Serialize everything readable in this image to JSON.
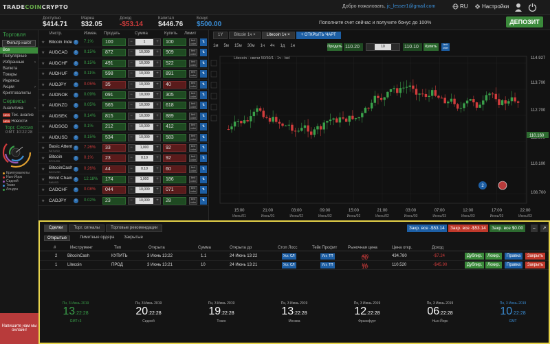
{
  "app": {
    "logo_a": "TRADE",
    "logo_b": "COIN",
    "logo_c": "CRYPTO",
    "welcome": "Добро пожаловать,",
    "email": "jc_lesser1@gmail.com",
    "lang": "RU",
    "settings": "Настройки"
  },
  "balances": [
    {
      "label": "Доступно",
      "value": "$414.71",
      "tone": "normal"
    },
    {
      "label": "Маржа",
      "value": "$32.05",
      "tone": "normal"
    },
    {
      "label": "Доход",
      "value": "-$53.14",
      "tone": "red"
    },
    {
      "label": "Капитал",
      "value": "$446.76",
      "tone": "normal"
    },
    {
      "label": "Бонус",
      "value": "$500.00",
      "tone": "blue"
    }
  ],
  "promo": "Пополните счет сейчас и получите бонус до 100%",
  "deposit_label": "ДЕПОЗИТ",
  "sidebar": {
    "trading_title": "Торговля",
    "filter_label": "Фильтр на/от",
    "categories": [
      {
        "label": "Все",
        "active": true,
        "arrow": false
      },
      {
        "label": "Популярные",
        "active": false,
        "arrow": false
      },
      {
        "label": "Избранные",
        "active": false,
        "arrow": true
      },
      {
        "label": "Валюта",
        "active": false,
        "arrow": false
      },
      {
        "label": "Товары",
        "active": false,
        "arrow": false
      },
      {
        "label": "Индексы",
        "active": false,
        "arrow": false
      },
      {
        "label": "Акции",
        "active": false,
        "arrow": true
      },
      {
        "label": "Криптовалюты",
        "active": false,
        "arrow": false
      }
    ],
    "services_title": "Сервисы",
    "services": [
      {
        "label": "Аналитика",
        "new": false,
        "arrow": true
      },
      {
        "label": "Тех. анализ",
        "new": true,
        "arrow": false
      },
      {
        "label": "Новости",
        "new": true,
        "arrow": false
      }
    ],
    "new_badge": "NEW",
    "clock_title": "Торг. Сессия",
    "clock_sub": "GMT: 10:22:28",
    "legend": [
      {
        "label": "Криптовалюты",
        "color": "#e0a030"
      },
      {
        "label": "Нью-Йорк",
        "color": "#d23c3c"
      },
      {
        "label": "Сидней",
        "color": "#9b59b6"
      },
      {
        "label": "Токио",
        "color": "#3b8fd8"
      },
      {
        "label": "Лондон",
        "color": "#3aa04a"
      }
    ],
    "message_box": "Напишите нам мы онлайн!"
  },
  "instruments": {
    "headers": {
      "instr": "Инстр.",
      "change": "Измен.",
      "sell": "Продать",
      "amount": "Сумма",
      "buy": "Купить",
      "limit": "Лимит"
    },
    "rows": [
      {
        "name": "Bitcoin Index",
        "sub": "",
        "change": "7.1%",
        "dir": "up",
        "sell": "100",
        "qty": "1",
        "buy": "100",
        "sell_tone": "green",
        "buy_tone": "green"
      },
      {
        "name": "AUDCAD",
        "sub": "",
        "change": "0.15%",
        "dir": "up",
        "sell": "872",
        "qty": "10,000",
        "buy": "909",
        "sell_tone": "green",
        "buy_tone": "green"
      },
      {
        "name": "AUDCHF",
        "sub": "",
        "change": "0.15%",
        "dir": "up",
        "sell": "491",
        "qty": "10,000",
        "buy": "522",
        "sell_tone": "green",
        "buy_tone": "green"
      },
      {
        "name": "AUDHUF",
        "sub": "",
        "change": "0.11%",
        "dir": "up",
        "sell": "598",
        "qty": "10,000",
        "buy": "891",
        "sell_tone": "green",
        "buy_tone": "green"
      },
      {
        "name": "AUDJPY",
        "sub": "",
        "change": "0.05%",
        "dir": "down",
        "sell": "35",
        "qty": "10,000",
        "buy": "40",
        "sell_tone": "red",
        "buy_tone": "red"
      },
      {
        "name": "AUDNOK",
        "sub": "",
        "change": "0.09%",
        "dir": "up",
        "sell": "091",
        "qty": "10,000",
        "buy": "305",
        "sell_tone": "green",
        "buy_tone": "green"
      },
      {
        "name": "AUDNZD",
        "sub": "",
        "change": "0.05%",
        "dir": "up",
        "sell": "565",
        "qty": "10,000",
        "buy": "618",
        "sell_tone": "green",
        "buy_tone": "green"
      },
      {
        "name": "AUDSEK",
        "sub": "",
        "change": "0.14%",
        "dir": "up",
        "sell": "815",
        "qty": "10,000",
        "buy": "889",
        "sell_tone": "green",
        "buy_tone": "green"
      },
      {
        "name": "AUDSGD",
        "sub": "",
        "change": "0.1%",
        "dir": "up",
        "sell": "212",
        "qty": "10,000",
        "buy": "412",
        "sell_tone": "green",
        "buy_tone": "green"
      },
      {
        "name": "AUDUSD",
        "sub": "",
        "change": "0.15%",
        "dir": "up",
        "sell": "534",
        "qty": "10,000",
        "buy": "583",
        "sell_tone": "green",
        "buy_tone": "green"
      },
      {
        "name": "Basic Attent",
        "sub": "BATUSD",
        "change": "7.26%",
        "dir": "down",
        "sell": "33",
        "qty": "1,000",
        "buy": "92",
        "sell_tone": "red",
        "buy_tone": "red"
      },
      {
        "name": "Bitcoin",
        "sub": "BTCUSD",
        "change": "0.1%",
        "dir": "down",
        "sell": "23",
        "qty": "0.10",
        "buy": "92",
        "sell_tone": "red",
        "buy_tone": "red"
      },
      {
        "name": "BitcoinCash",
        "sub": "BCHUSD",
        "change": "0.26%",
        "dir": "down",
        "sell": "44",
        "qty": "0.10",
        "buy": "60",
        "sell_tone": "red",
        "buy_tone": "red"
      },
      {
        "name": "Bmnt Chain",
        "sub": "BMUSD",
        "change": "12.18%",
        "dir": "up",
        "sell": "174",
        "qty": "1,000",
        "buy": "186",
        "sell_tone": "green",
        "buy_tone": "green"
      },
      {
        "name": "CADCHF",
        "sub": "",
        "change": "0.08%",
        "dir": "down",
        "sell": "044",
        "qty": "10,000",
        "buy": "071",
        "sell_tone": "red",
        "buy_tone": "red"
      },
      {
        "name": "CADJPY",
        "sub": "",
        "change": "0.02%",
        "dir": "up",
        "sell": "23",
        "qty": "10,000",
        "buy": "28",
        "sell_tone": "green",
        "buy_tone": "green"
      }
    ]
  },
  "chart": {
    "tabs": [
      {
        "label": "1Y",
        "active": false
      },
      {
        "label": "Bitcoin 1ч",
        "active": false
      },
      {
        "label": "Litecoin 1ч",
        "active": true
      }
    ],
    "open_tab": "+ ОТКРЫТЬ ЧАРТ",
    "timeframes": [
      "1м",
      "5м",
      "15м",
      "30м",
      "1ч",
      "4ч",
      "1д",
      "1н"
    ],
    "title": "Litecoin - свечи 50/50/1 - 1ч - bid",
    "trade": {
      "sell_label": "Продать",
      "sell_price": "110.20",
      "qty": "10",
      "buy_price": "110.10",
      "buy_label": "Купить"
    },
    "y_ticks": [
      "114.927",
      "113.700",
      "112.700",
      "111.600",
      "110.100",
      "108.700"
    ],
    "current_price": "110.160",
    "x_ticks": [
      {
        "t": "15:00",
        "d": "Июнь/01"
      },
      {
        "t": "21:00",
        "d": "Июнь/01"
      },
      {
        "t": "03:00",
        "d": "Июнь/02"
      },
      {
        "t": "09:00",
        "d": "Июнь/02"
      },
      {
        "t": "15:00",
        "d": "Июнь/02"
      },
      {
        "t": "21:00",
        "d": "Июнь/02"
      },
      {
        "t": "03:00",
        "d": "Июнь/03"
      },
      {
        "t": "07:00",
        "d": "Июнь/03"
      },
      {
        "t": "12:00",
        "d": "Июнь/03"
      },
      {
        "t": "17:00",
        "d": "Июнь/03"
      },
      {
        "t": "22:00",
        "d": "Июнь/03"
      }
    ],
    "badge": "2"
  },
  "trades": {
    "tabs": [
      {
        "label": "Сделки",
        "active": true
      },
      {
        "label": "Торг. сигналы",
        "active": false
      },
      {
        "label": "Торговые рекомендации",
        "active": false
      }
    ],
    "close_all": [
      {
        "label": "Закр. все -$53.14",
        "color": "#1d5fa5"
      },
      {
        "label": "Закр. все -$53.14",
        "color": "#c0392b"
      },
      {
        "label": "Закр. все $0.00",
        "color": "#2d6b30"
      }
    ],
    "sub_tabs": [
      {
        "label": "Открытые",
        "active": true
      },
      {
        "label": "Лимитные ордера",
        "active": false
      },
      {
        "label": "Закрытые",
        "active": false
      }
    ],
    "headers": {
      "num": "#",
      "instr": "Инструмент",
      "type": "Тип",
      "opened": "Открыта",
      "amount": "Сумма",
      "open_until": "Открыта до",
      "sl": "Стоп Лосс",
      "tp": "Тейк Профит",
      "market": "Рыночная цена",
      "open_price": "Цена откр.",
      "income": "Доход"
    },
    "rows": [
      {
        "num": "2",
        "instr": "BitcoinCash",
        "type": "КУПИТЬ",
        "opened": "3 Июнь 13:22",
        "amount": "1.1",
        "until": "24 Июнь 13:22",
        "sl": "Уст. СЛ",
        "tp": "Уст. ТП",
        "mp_small": "420.",
        "mp_big": "00",
        "open_price": "434.780",
        "income": "-$7.24"
      },
      {
        "num": "1",
        "instr": "Litecoin",
        "type": "ПРОД",
        "opened": "3 Июнь 13:21",
        "amount": "10",
        "until": "24 Июнь 13:21",
        "sl": "Уст. СЛ",
        "tp": "Уст. ТП",
        "mp_small": "111.",
        "mp_big": "10",
        "open_price": "110.520",
        "income": "-$45.90"
      }
    ],
    "actions": [
      "Дублир.",
      "Локир.",
      "Правка",
      "Закрыть"
    ],
    "clocks": [
      {
        "date": "Пн, 3 Июнь 2019",
        "h": "13",
        "ms": ":22:28",
        "city": "GMT+3",
        "tone": "green"
      },
      {
        "date": "Пн, 3 Июнь 2019",
        "h": "20",
        "ms": ":22:28",
        "city": "Сидней",
        "tone": "white"
      },
      {
        "date": "Пн, 3 Июнь 2019",
        "h": "19",
        "ms": ":22:28",
        "city": "Токио",
        "tone": "white"
      },
      {
        "date": "Пн, 3 Июнь 2019",
        "h": "13",
        "ms": ":22:28",
        "city": "Москва",
        "tone": "white"
      },
      {
        "date": "Пн, 3 Июнь 2019",
        "h": "12",
        "ms": ":22:28",
        "city": "Франкфурт",
        "tone": "white"
      },
      {
        "date": "Пн, 3 Июнь 2019",
        "h": "06",
        "ms": ":22:28",
        "city": "Нью-Йорк",
        "tone": "white"
      },
      {
        "date": "Пн, 3 Июнь 2019",
        "h": "10",
        "ms": ":22:28",
        "city": "GMT",
        "tone": "blue"
      }
    ]
  }
}
